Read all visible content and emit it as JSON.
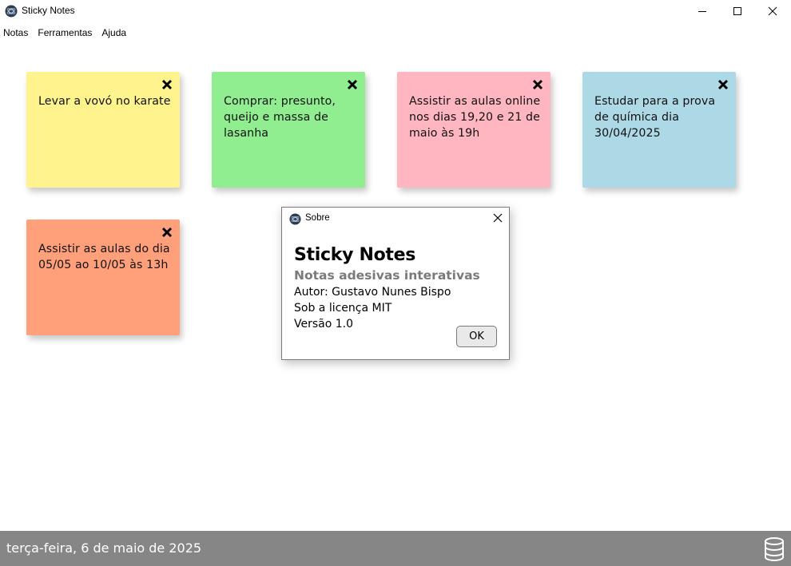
{
  "window": {
    "title": "Sticky Notes"
  },
  "menu": {
    "items": [
      {
        "label": "Notas"
      },
      {
        "label": "Ferramentas"
      },
      {
        "label": "Ajuda"
      }
    ]
  },
  "notes": [
    {
      "text": "Levar a vovó no karate",
      "color": "#fef38c"
    },
    {
      "text": "Comprar: presunto, queijo e massa de lasanha",
      "color": "#90ee90"
    },
    {
      "text": "Assistir as aulas online nos dias 19,20 e 21 de maio às 19h",
      "color": "#ffb6c1"
    },
    {
      "text": "Estudar para a prova de química dia 30/04/2025",
      "color": "#add8e6"
    },
    {
      "text": "Assistir as aulas do dia 05/05 ao 10/05 às 13h",
      "color": "#ffa07a"
    }
  ],
  "dialog": {
    "title": "Sobre",
    "app_name": "Sticky Notes",
    "subtitle": "Notas adesivas interativas",
    "author": "Autor: Gustavo Nunes Bispo",
    "license": "Sob a licença MIT",
    "version": "Versão 1.0",
    "ok_label": "OK"
  },
  "status": {
    "date": "terça-feira, 6 de maio de 2025",
    "background": "#868686"
  },
  "icons": {
    "app": "app-logo-icon",
    "minimize": "minimize-icon",
    "maximize": "maximize-icon",
    "close": "close-icon",
    "note_close": "close-x-icon",
    "database": "database-icon"
  }
}
